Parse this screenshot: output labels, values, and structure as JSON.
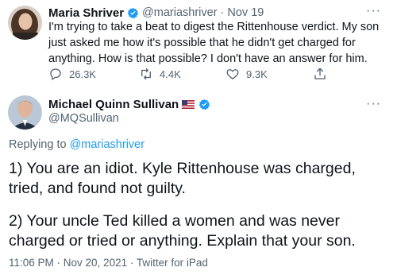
{
  "tweet1": {
    "name": "Maria Shriver",
    "handle": "@mariashriver",
    "date": "Nov 19",
    "text": "I'm trying to take a beat to digest the Rittenhouse verdict. My son just asked me how it's possible that he didn't get charged for anything. How is that possible? I don't have an answer for him.",
    "actions": {
      "replies": "26.3K",
      "retweets": "4.4K",
      "likes": "9.3K"
    },
    "separator": "·"
  },
  "tweet2": {
    "name": "Michael Quinn Sullivan",
    "flag_icon": "us-flag-icon",
    "handle": "@MQSullivan",
    "replying_label": "Replying to",
    "replying_to": "@mariashriver",
    "paragraph1": "1) You are an idiot. Kyle Rittenhouse was charged, tried, and found not guilty.",
    "paragraph2": "2) Your uncle Ted killed a women and was never charged or tried or anything. Explain that your son.",
    "meta": "11:06 PM · Nov 20, 2021 · Twitter for iPad"
  },
  "colors": {
    "verified_blue": "#1d9bf0",
    "muted_gray": "#536471",
    "text": "#0f1419"
  }
}
